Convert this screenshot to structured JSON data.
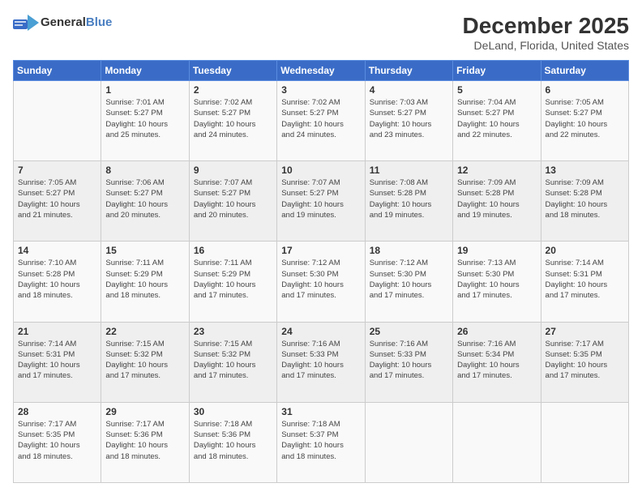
{
  "header": {
    "logo_general": "General",
    "logo_blue": "Blue",
    "month_title": "December 2025",
    "location": "DeLand, Florida, United States"
  },
  "calendar": {
    "days_of_week": [
      "Sunday",
      "Monday",
      "Tuesday",
      "Wednesday",
      "Thursday",
      "Friday",
      "Saturday"
    ],
    "weeks": [
      [
        {
          "num": "",
          "info": ""
        },
        {
          "num": "1",
          "info": "Sunrise: 7:01 AM\nSunset: 5:27 PM\nDaylight: 10 hours\nand 25 minutes."
        },
        {
          "num": "2",
          "info": "Sunrise: 7:02 AM\nSunset: 5:27 PM\nDaylight: 10 hours\nand 24 minutes."
        },
        {
          "num": "3",
          "info": "Sunrise: 7:02 AM\nSunset: 5:27 PM\nDaylight: 10 hours\nand 24 minutes."
        },
        {
          "num": "4",
          "info": "Sunrise: 7:03 AM\nSunset: 5:27 PM\nDaylight: 10 hours\nand 23 minutes."
        },
        {
          "num": "5",
          "info": "Sunrise: 7:04 AM\nSunset: 5:27 PM\nDaylight: 10 hours\nand 22 minutes."
        },
        {
          "num": "6",
          "info": "Sunrise: 7:05 AM\nSunset: 5:27 PM\nDaylight: 10 hours\nand 22 minutes."
        }
      ],
      [
        {
          "num": "7",
          "info": "Sunrise: 7:05 AM\nSunset: 5:27 PM\nDaylight: 10 hours\nand 21 minutes."
        },
        {
          "num": "8",
          "info": "Sunrise: 7:06 AM\nSunset: 5:27 PM\nDaylight: 10 hours\nand 20 minutes."
        },
        {
          "num": "9",
          "info": "Sunrise: 7:07 AM\nSunset: 5:27 PM\nDaylight: 10 hours\nand 20 minutes."
        },
        {
          "num": "10",
          "info": "Sunrise: 7:07 AM\nSunset: 5:27 PM\nDaylight: 10 hours\nand 19 minutes."
        },
        {
          "num": "11",
          "info": "Sunrise: 7:08 AM\nSunset: 5:28 PM\nDaylight: 10 hours\nand 19 minutes."
        },
        {
          "num": "12",
          "info": "Sunrise: 7:09 AM\nSunset: 5:28 PM\nDaylight: 10 hours\nand 19 minutes."
        },
        {
          "num": "13",
          "info": "Sunrise: 7:09 AM\nSunset: 5:28 PM\nDaylight: 10 hours\nand 18 minutes."
        }
      ],
      [
        {
          "num": "14",
          "info": "Sunrise: 7:10 AM\nSunset: 5:28 PM\nDaylight: 10 hours\nand 18 minutes."
        },
        {
          "num": "15",
          "info": "Sunrise: 7:11 AM\nSunset: 5:29 PM\nDaylight: 10 hours\nand 18 minutes."
        },
        {
          "num": "16",
          "info": "Sunrise: 7:11 AM\nSunset: 5:29 PM\nDaylight: 10 hours\nand 17 minutes."
        },
        {
          "num": "17",
          "info": "Sunrise: 7:12 AM\nSunset: 5:30 PM\nDaylight: 10 hours\nand 17 minutes."
        },
        {
          "num": "18",
          "info": "Sunrise: 7:12 AM\nSunset: 5:30 PM\nDaylight: 10 hours\nand 17 minutes."
        },
        {
          "num": "19",
          "info": "Sunrise: 7:13 AM\nSunset: 5:30 PM\nDaylight: 10 hours\nand 17 minutes."
        },
        {
          "num": "20",
          "info": "Sunrise: 7:14 AM\nSunset: 5:31 PM\nDaylight: 10 hours\nand 17 minutes."
        }
      ],
      [
        {
          "num": "21",
          "info": "Sunrise: 7:14 AM\nSunset: 5:31 PM\nDaylight: 10 hours\nand 17 minutes."
        },
        {
          "num": "22",
          "info": "Sunrise: 7:15 AM\nSunset: 5:32 PM\nDaylight: 10 hours\nand 17 minutes."
        },
        {
          "num": "23",
          "info": "Sunrise: 7:15 AM\nSunset: 5:32 PM\nDaylight: 10 hours\nand 17 minutes."
        },
        {
          "num": "24",
          "info": "Sunrise: 7:16 AM\nSunset: 5:33 PM\nDaylight: 10 hours\nand 17 minutes."
        },
        {
          "num": "25",
          "info": "Sunrise: 7:16 AM\nSunset: 5:33 PM\nDaylight: 10 hours\nand 17 minutes."
        },
        {
          "num": "26",
          "info": "Sunrise: 7:16 AM\nSunset: 5:34 PM\nDaylight: 10 hours\nand 17 minutes."
        },
        {
          "num": "27",
          "info": "Sunrise: 7:17 AM\nSunset: 5:35 PM\nDaylight: 10 hours\nand 17 minutes."
        }
      ],
      [
        {
          "num": "28",
          "info": "Sunrise: 7:17 AM\nSunset: 5:35 PM\nDaylight: 10 hours\nand 18 minutes."
        },
        {
          "num": "29",
          "info": "Sunrise: 7:17 AM\nSunset: 5:36 PM\nDaylight: 10 hours\nand 18 minutes."
        },
        {
          "num": "30",
          "info": "Sunrise: 7:18 AM\nSunset: 5:36 PM\nDaylight: 10 hours\nand 18 minutes."
        },
        {
          "num": "31",
          "info": "Sunrise: 7:18 AM\nSunset: 5:37 PM\nDaylight: 10 hours\nand 18 minutes."
        },
        {
          "num": "",
          "info": ""
        },
        {
          "num": "",
          "info": ""
        },
        {
          "num": "",
          "info": ""
        }
      ]
    ]
  }
}
